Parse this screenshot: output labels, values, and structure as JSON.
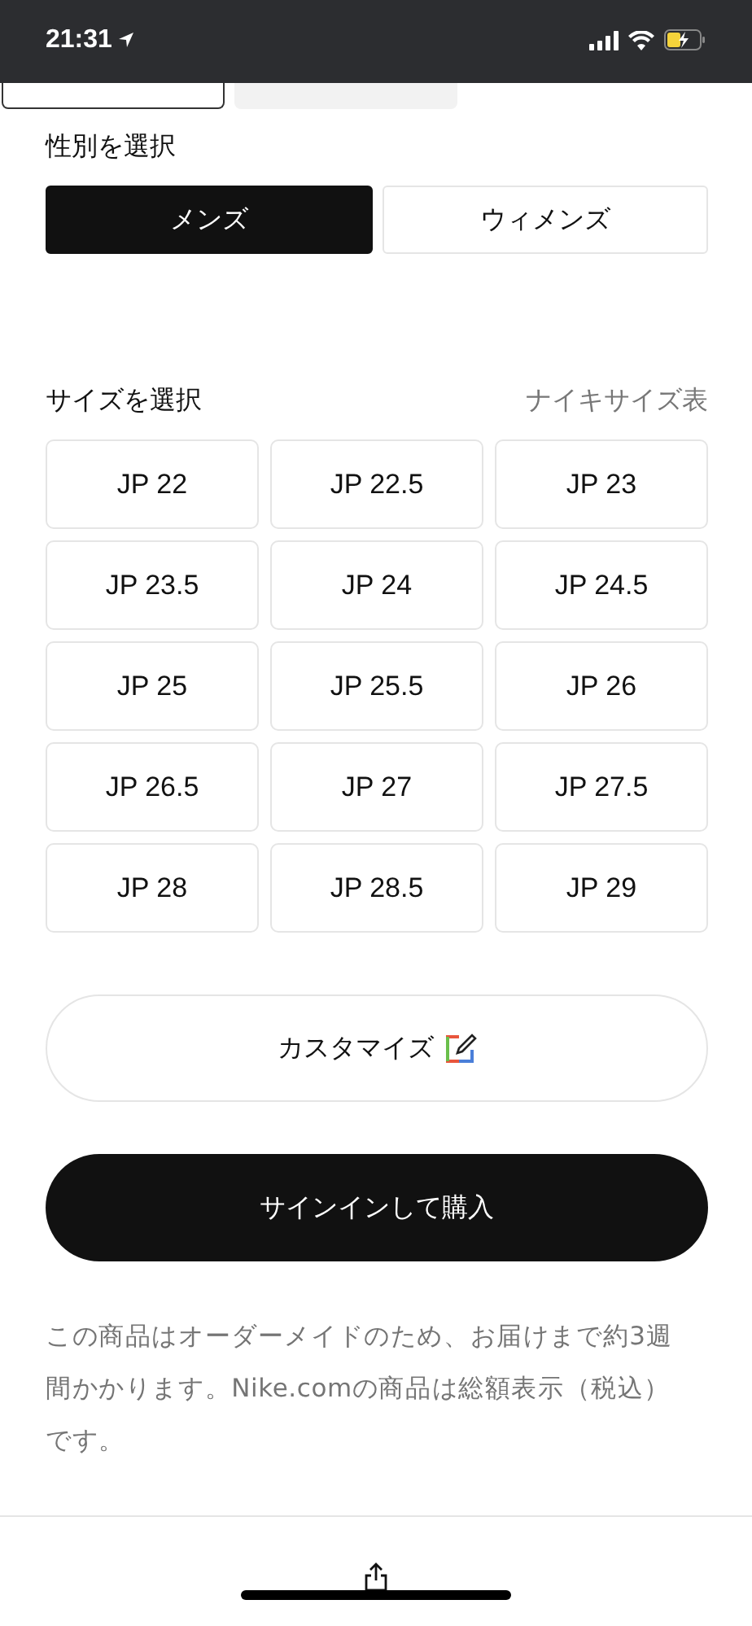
{
  "status_bar": {
    "time": "21:31"
  },
  "gender": {
    "label": "性別を選択",
    "options": [
      {
        "label": "メンズ",
        "selected": true
      },
      {
        "label": "ウィメンズ",
        "selected": false
      }
    ]
  },
  "size": {
    "label": "サイズを選択",
    "chart_link": "ナイキサイズ表",
    "options": [
      {
        "label": "JP 22",
        "selected": false
      },
      {
        "label": "JP 22.5",
        "selected": false
      },
      {
        "label": "JP 23",
        "selected": false
      },
      {
        "label": "JP 23.5",
        "selected": false
      },
      {
        "label": "JP 24",
        "selected": false
      },
      {
        "label": "JP 24.5",
        "selected": false
      },
      {
        "label": "JP 25",
        "selected": false
      },
      {
        "label": "JP 25.5",
        "selected": false
      },
      {
        "label": "JP 26",
        "selected": false
      },
      {
        "label": "JP 26.5",
        "selected": false
      },
      {
        "label": "JP 27",
        "selected": false
      },
      {
        "label": "JP 27.5",
        "selected": false
      },
      {
        "label": "JP 28",
        "selected": false
      },
      {
        "label": "JP 28.5",
        "selected": false
      },
      {
        "label": "JP 29",
        "selected": false
      }
    ]
  },
  "customize_button": "カスタマイズ",
  "buy_button": "サインインして購入",
  "note": "この商品はオーダーメイドのため、お届けまで約3週間かかります。Nike.comの商品は総額表示（税込）です。"
}
